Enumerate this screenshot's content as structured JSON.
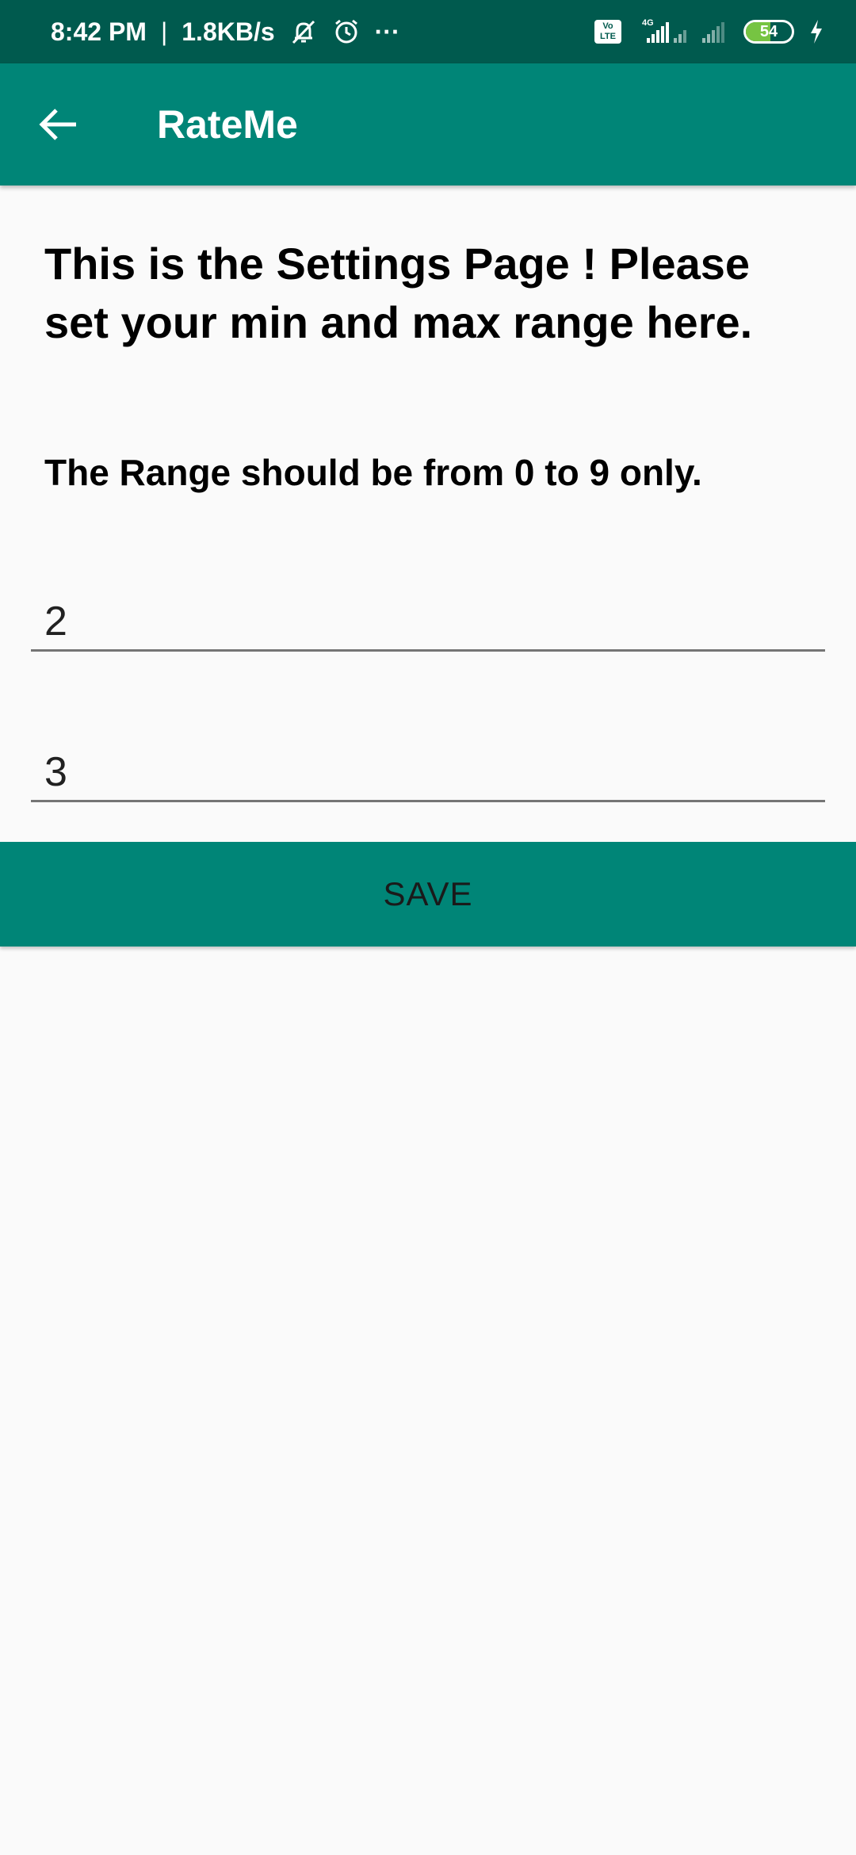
{
  "status_bar": {
    "time": "8:42 PM",
    "separator": "|",
    "speed": "1.8KB/s",
    "more": "···",
    "volte_line1": "Vo",
    "volte_line2": "LTE",
    "network_type": "4G",
    "battery_level": "54",
    "icons": [
      "mute-bell-icon",
      "alarm-clock-icon",
      "volte-icon",
      "signal-icon",
      "battery-icon",
      "charging-icon"
    ]
  },
  "app_bar": {
    "title": "RateMe",
    "back_icon": "arrow-left-icon",
    "color": "#008577"
  },
  "main": {
    "heading": "This is the Settings Page ! Please set your min and max range here.",
    "subheading": "The Range should be from 0 to 9 only.",
    "min_value": "2",
    "max_value": "3",
    "save_label": "SAVE"
  },
  "colors": {
    "status_bar": "#005a4e",
    "primary": "#008577",
    "background": "#fafafa",
    "battery_fill": "#76c442"
  }
}
